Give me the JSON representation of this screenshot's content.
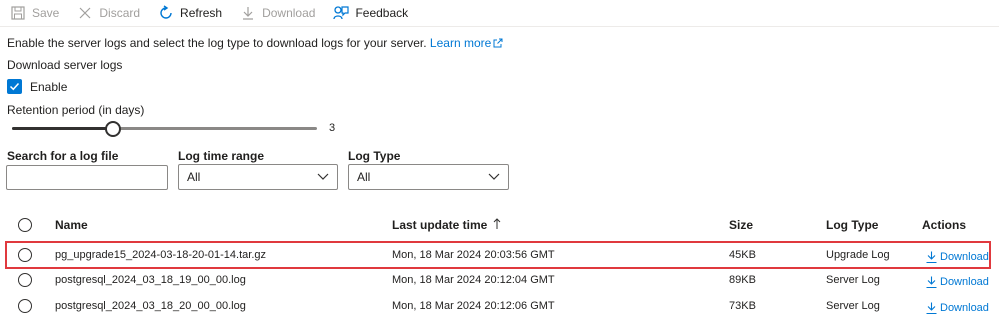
{
  "toolbar": {
    "save": "Save",
    "discard": "Discard",
    "refresh": "Refresh",
    "download": "Download",
    "feedback": "Feedback"
  },
  "description": {
    "text": "Enable the server logs and select the log type to download logs for your server.",
    "link": "Learn more"
  },
  "download_logs": {
    "title": "Download server logs",
    "enable_label": "Enable",
    "enabled": true
  },
  "retention": {
    "label": "Retention period (in days)",
    "value": "3",
    "level": 0.33
  },
  "filters": {
    "search_label": "Search for a log file",
    "search_value": "",
    "time_range_label": "Log time range",
    "time_range_value": "All",
    "log_type_label": "Log Type",
    "log_type_value": "All"
  },
  "table": {
    "headers": {
      "name": "Name",
      "last_update": "Last update time",
      "size": "Size",
      "log_type": "Log Type",
      "actions": "Actions"
    },
    "rows": [
      {
        "name": "pg_upgrade15_2024-03-18-20-01-14.tar.gz",
        "time": "Mon, 18 Mar 2024 20:03:56 GMT",
        "size": "45KB",
        "type": "Upgrade Log",
        "action": "Download"
      },
      {
        "name": "postgresql_2024_03_18_19_00_00.log",
        "time": "Mon, 18 Mar 2024 20:12:04 GMT",
        "size": "89KB",
        "type": "Server Log",
        "action": "Download"
      },
      {
        "name": "postgresql_2024_03_18_20_00_00.log",
        "time": "Mon, 18 Mar 2024 20:12:06 GMT",
        "size": "73KB",
        "type": "Server Log",
        "action": "Download"
      }
    ]
  },
  "colors": {
    "accent": "#0078d4",
    "highlight": "#e0393e"
  }
}
